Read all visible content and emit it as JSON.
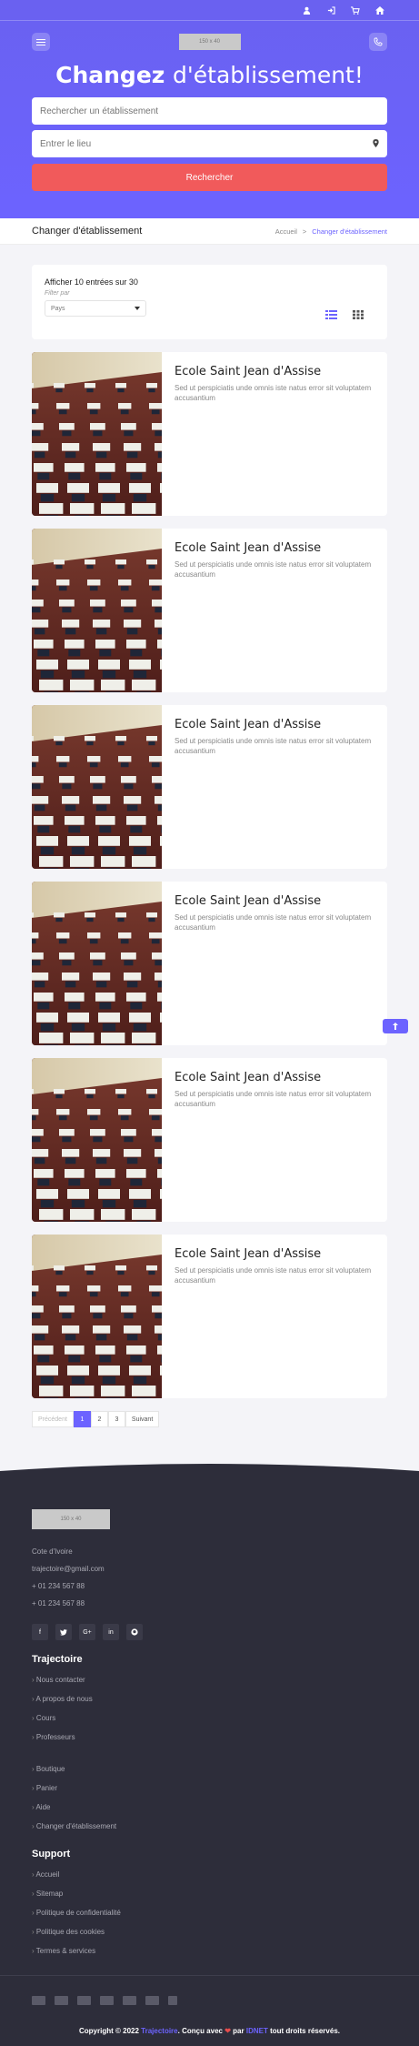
{
  "header": {
    "logo_text": "150 x 40",
    "title_bold": "Changez",
    "title_rest": "d'établissement!",
    "search_placeholder": "Rechercher un établissement",
    "location_placeholder": "Entrer le lieu",
    "search_button": "Rechercher"
  },
  "breadcrumb": {
    "page_title": "Changer d'établissement",
    "home": "Accueil",
    "separator": ">",
    "current": "Changer d'établissement"
  },
  "filter": {
    "count_text": "Afficher 10 entrées sur 30",
    "filter_label": "Filter par",
    "select_value": "Pays"
  },
  "cards": [
    {
      "title": "Ecole Saint Jean d'Assise",
      "description": "Sed ut perspiciatis unde omnis iste natus error sit voluptatem accusantium"
    },
    {
      "title": "Ecole Saint Jean d'Assise",
      "description": "Sed ut perspiciatis unde omnis iste natus error sit voluptatem accusantium"
    },
    {
      "title": "Ecole Saint Jean d'Assise",
      "description": "Sed ut perspiciatis unde omnis iste natus error sit voluptatem accusantium"
    },
    {
      "title": "Ecole Saint Jean d'Assise",
      "description": "Sed ut perspiciatis unde omnis iste natus error sit voluptatem accusantium"
    },
    {
      "title": "Ecole Saint Jean d'Assise",
      "description": "Sed ut perspiciatis unde omnis iste natus error sit voluptatem accusantium"
    },
    {
      "title": "Ecole Saint Jean d'Assise",
      "description": "Sed ut perspiciatis unde omnis iste natus error sit voluptatem accusantium"
    }
  ],
  "pagination": {
    "prev": "Précédent",
    "pages": [
      "1",
      "2",
      "3"
    ],
    "next": "Suivant"
  },
  "footer": {
    "logo_text": "150 x 40",
    "country": "Cote d'Ivoire",
    "email": "trajectoire@gmail.com",
    "phone1": "+ 01 234 567 88",
    "phone2": "+ 01 234 567 88",
    "section1_title": "Trajectoire",
    "section1_items": [
      "Nous contacter",
      "A propos de nous",
      "Cours",
      "Professeurs"
    ],
    "section1b_items": [
      "Boutique",
      "Panier",
      "Aide",
      "Changer d'établissement"
    ],
    "section2_title": "Support",
    "section2_items": [
      "Accueil",
      "Sitemap",
      "Politique de confidentialité",
      "Politique des cookies",
      "Termes & services"
    ],
    "copyright_prefix": "Copyright © 2022",
    "copyright_brand": "Trajectoire",
    "copyright_mid": ". Conçu avec",
    "copyright_heart": "❤",
    "copyright_par": "par",
    "copyright_author": "IDNET",
    "copyright_suffix": "tout droits réservés."
  },
  "colors": {
    "accent": "#6c63ff",
    "button_red": "#f15a5b",
    "footer_bg": "#2d2d3a"
  },
  "icons": {
    "topbar": [
      "user-icon",
      "sign-in-icon",
      "cart-icon",
      "home-icon"
    ],
    "socials": [
      "facebook-icon",
      "twitter-icon",
      "google-plus-icon",
      "linkedin-icon",
      "github-icon"
    ]
  }
}
